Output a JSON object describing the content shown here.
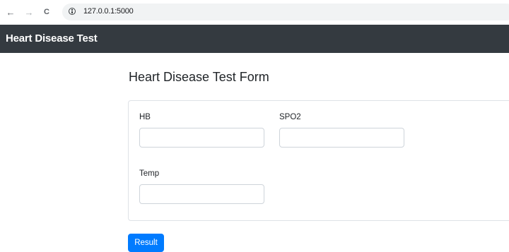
{
  "browser": {
    "back_glyph": "←",
    "forward_glyph": "→",
    "reload_glyph": "C",
    "url": "127.0.0.1:5000"
  },
  "navbar": {
    "brand": "Heart Disease Test"
  },
  "form": {
    "title": "Heart Disease Test Form",
    "fields": [
      {
        "label": "HB",
        "value": "",
        "placeholder": ""
      },
      {
        "label": "SPO2",
        "value": "",
        "placeholder": ""
      },
      {
        "label": "Temp",
        "value": "",
        "placeholder": ""
      }
    ],
    "submit_label": "Result"
  },
  "colors": {
    "navbar_bg": "#343a40",
    "primary": "#007bff",
    "card_border": "#dee2e6",
    "input_border": "#ced4da"
  }
}
